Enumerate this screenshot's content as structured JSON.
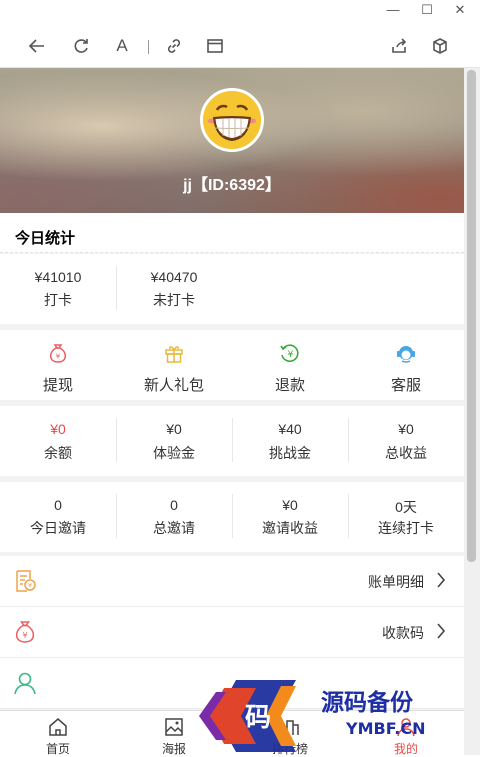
{
  "window": {
    "minimize_glyph": "—",
    "maximize_glyph": "☐",
    "close_glyph": "✕"
  },
  "toolbar": {
    "text_size_label": "A"
  },
  "profile": {
    "name": "jj【ID:6392】",
    "avatar_icon": "grinning-face-icon"
  },
  "stats": {
    "title": "今日统计",
    "items": [
      {
        "value": "¥41010",
        "label": "打卡"
      },
      {
        "value": "¥40470",
        "label": "未打卡"
      }
    ]
  },
  "actions": [
    {
      "label": "提现",
      "icon": "money-bag-icon",
      "color": "#e86060"
    },
    {
      "label": "新人礼包",
      "icon": "gift-icon",
      "color": "#e8b93a"
    },
    {
      "label": "退款",
      "icon": "refund-icon",
      "color": "#3aa93a"
    },
    {
      "label": "客服",
      "icon": "customer-service-icon",
      "color": "#46a6e6"
    }
  ],
  "balances": [
    {
      "value": "¥0",
      "label": "余额",
      "value_color": "#e84a4a"
    },
    {
      "value": "¥0",
      "label": "体验金"
    },
    {
      "value": "¥40",
      "label": "挑战金"
    },
    {
      "value": "¥0",
      "label": "总收益"
    }
  ],
  "invites": [
    {
      "value": "0",
      "label": "今日邀请"
    },
    {
      "value": "0",
      "label": "总邀请"
    },
    {
      "value": "¥0",
      "label": "邀请收益"
    },
    {
      "value": "0天",
      "label": "连续打卡"
    }
  ],
  "menu": [
    {
      "label": "账单明细",
      "icon": "bill-icon"
    },
    {
      "label": "收款码",
      "icon": "money-bag-icon"
    },
    {
      "label": "",
      "icon": "user-icon"
    }
  ],
  "tabbar": [
    {
      "label": "首页",
      "icon": "home-icon"
    },
    {
      "label": "海报",
      "icon": "image-icon"
    },
    {
      "label": "排行榜",
      "icon": "ranking-icon"
    },
    {
      "label": "我的",
      "icon": "user-icon"
    }
  ],
  "watermark": {
    "badge": "码",
    "title": "源码备份",
    "url": "YMBF.CN"
  }
}
